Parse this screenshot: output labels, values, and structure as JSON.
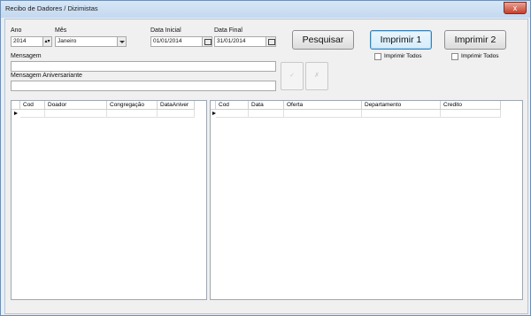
{
  "window": {
    "title": "Recibo de Dadores / Dizimistas",
    "close_glyph": "x"
  },
  "form": {
    "ano_label": "Ano",
    "ano_value": "2014",
    "mes_label": "Mês",
    "mes_value": "Janeiro",
    "data_inicial_label": "Data Inicial",
    "data_inicial_value": "01/01/2014",
    "data_final_label": "Data Final",
    "data_final_value": "31/01/2014",
    "mensagem_label": "Mensagem",
    "mensagem_value": "",
    "mensagem_aniv_label": "Mensagem Aniversariante",
    "mensagem_aniv_value": ""
  },
  "buttons": {
    "pesquisar": "Pesquisar",
    "imprimir1": "Imprimir 1",
    "imprimir2": "Imprimir 2",
    "imprimir_todos_1": "Imprimir Todos",
    "imprimir_todos_2": "Imprimir Todos",
    "confirm_glyph": "✓",
    "cancel_glyph": "✗"
  },
  "left_grid": {
    "columns": [
      "Cod",
      "Doador",
      "Congregação",
      "DataAniver"
    ]
  },
  "right_grid": {
    "columns": [
      "Cod",
      "Data",
      "Oferta",
      "Departamento",
      "Credito"
    ]
  },
  "icons": {
    "close": "close-icon",
    "calendar": "calendar-icon",
    "dropdown": "chevron-down-icon",
    "spinner": "spinner-icon",
    "row": "row-indicator-icon"
  }
}
